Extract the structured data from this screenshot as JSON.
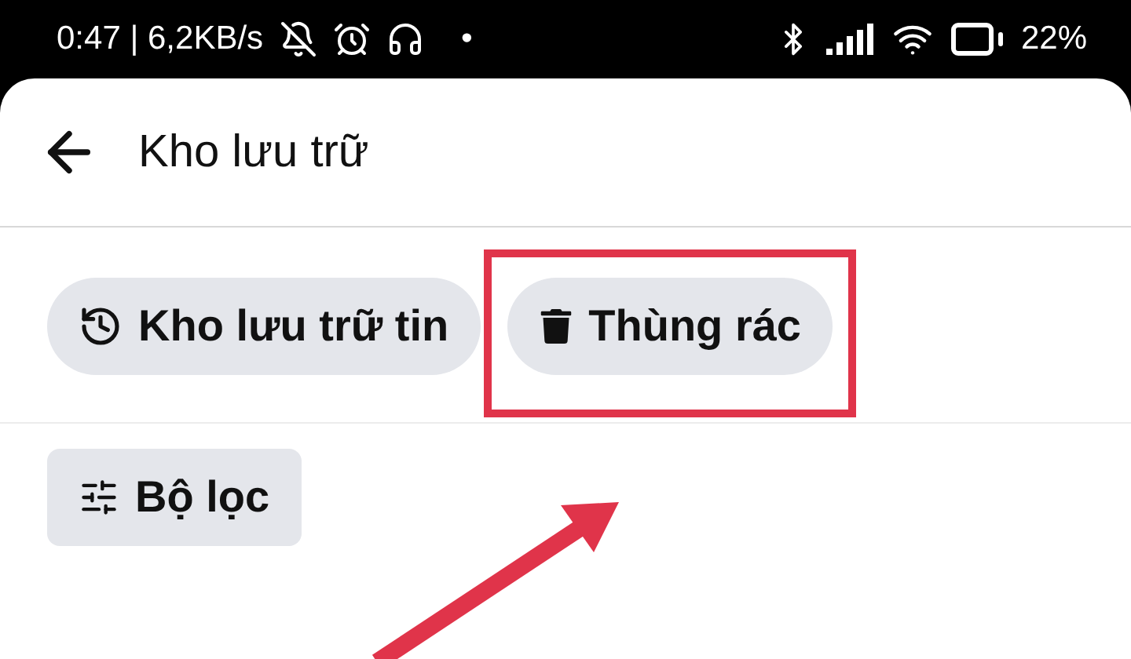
{
  "status_bar": {
    "time": "0:47 | 6,2KB/s",
    "dot": "•",
    "battery": "22%"
  },
  "header": {
    "title": "Kho lưu trữ"
  },
  "chips": [
    {
      "kind": "history",
      "label": "Kho lưu trữ tin",
      "highlighted": false
    },
    {
      "kind": "trash",
      "label": "Thùng rác",
      "highlighted": true
    }
  ],
  "filter": {
    "label": "Bộ lọc"
  },
  "annotation_arrow": true
}
